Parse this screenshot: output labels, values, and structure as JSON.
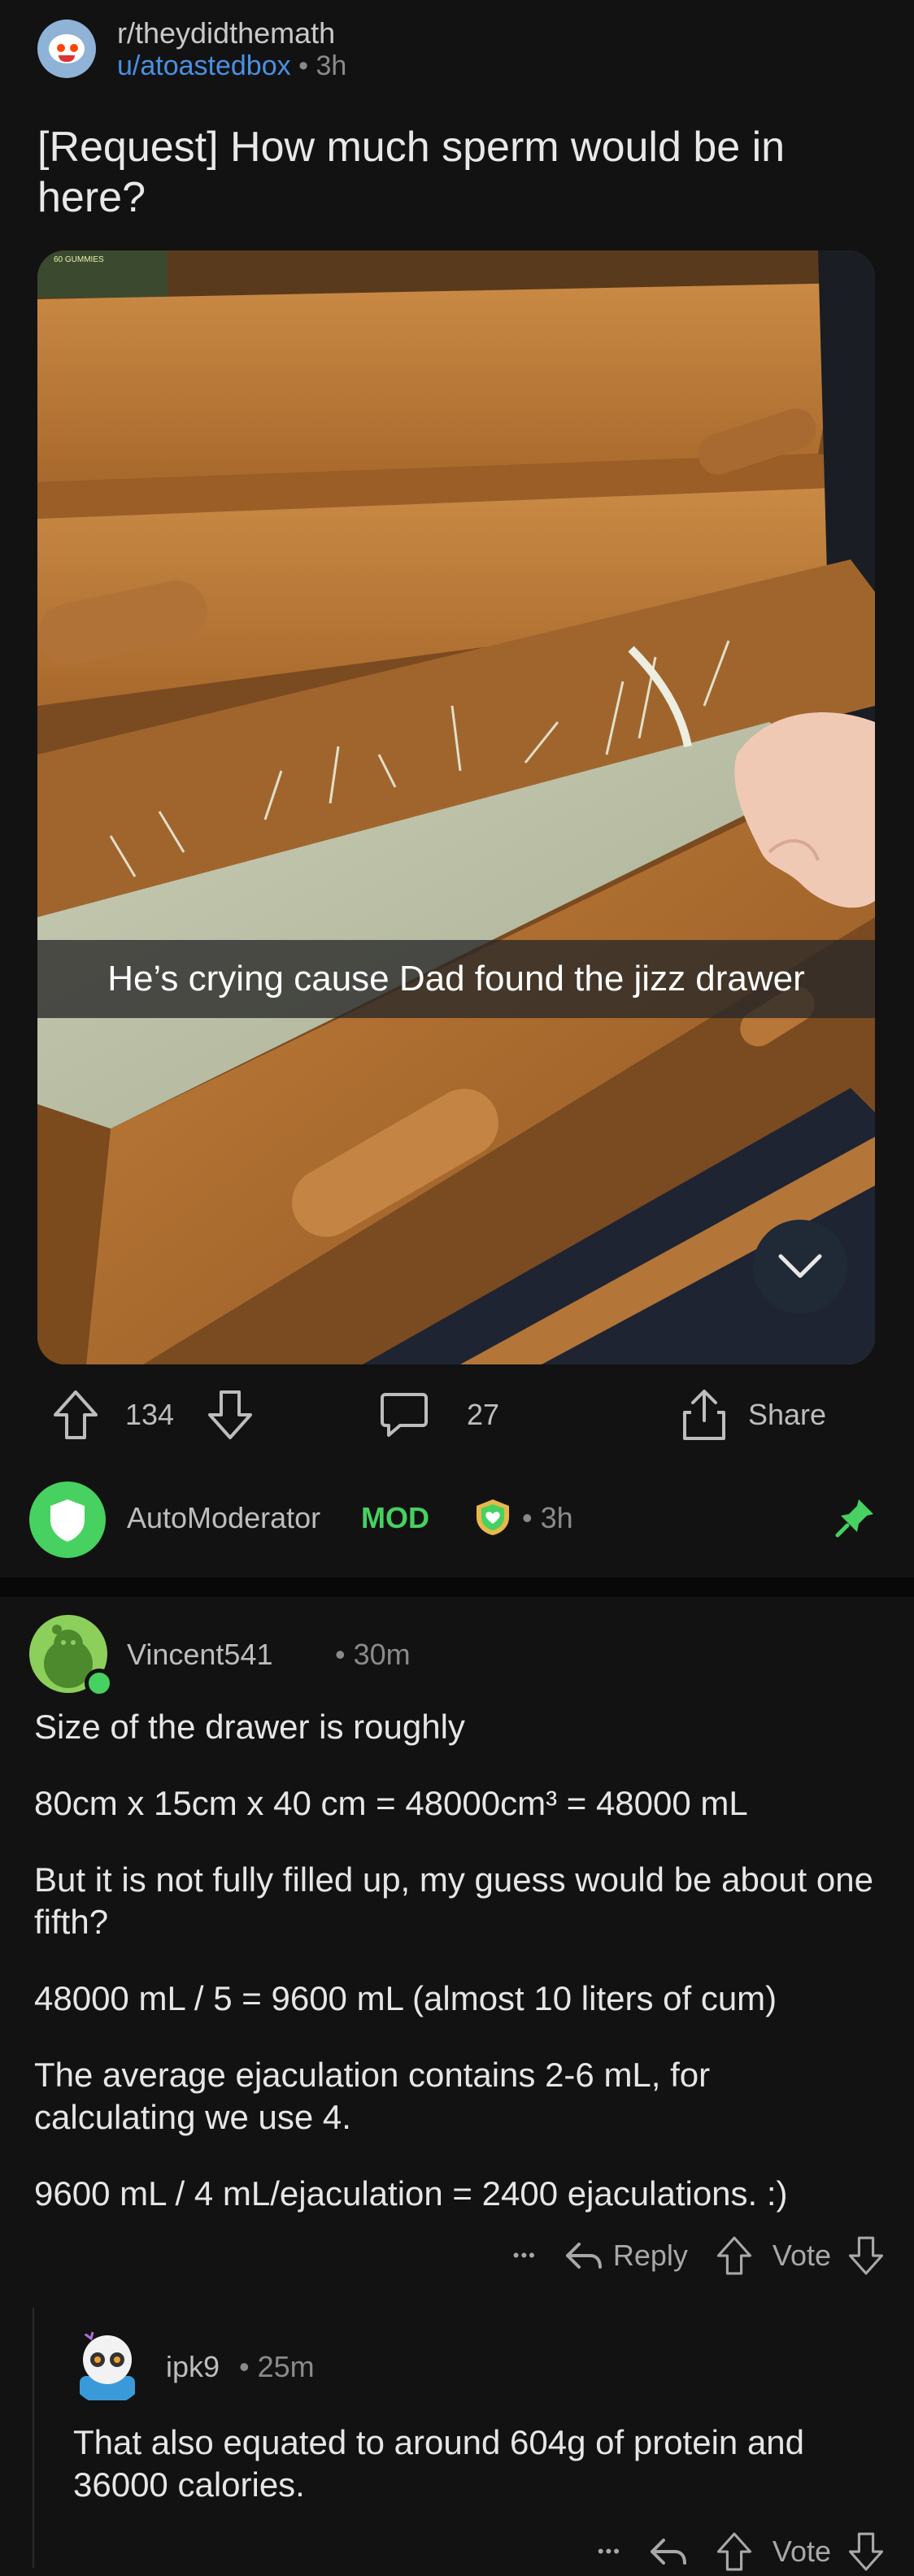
{
  "post": {
    "subreddit": "r/theydidthemath",
    "author": "u/atoastedbox",
    "separator": "•",
    "time": "3h",
    "title": "[Request] How much sperm would be in here?",
    "image_caption": "He’s crying cause Dad found the jizz drawer",
    "gummies_label": "60 GUMMIES",
    "upvotes": "134",
    "comments": "27",
    "share_label": "Share"
  },
  "automod": {
    "name": "AutoModerator",
    "badge": "MOD",
    "separator": "•",
    "time": "3h"
  },
  "comments": [
    {
      "author": "Vincent541",
      "separator": "•",
      "time": "30m",
      "paragraphs": [
        "Size of the drawer is roughly",
        "80cm x 15cm x 40 cm = 48000cm³ = 48000 mL",
        "But it is not fully filled up, my guess would be about one fifth?",
        "48000 mL / 5 = 9600 mL (almost 10 liters of cum)",
        "The average ejaculation contains 2-6 mL, for calculating we use 4.",
        "9600 mL / 4 mL/ejaculation = 2400 ejaculations. :)"
      ],
      "more": "•••",
      "reply": "Reply",
      "vote": "Vote"
    },
    {
      "author": "ipk9",
      "separator": "•",
      "time": "25m",
      "paragraphs": [
        "That also equated to around 604g of protein and 36000 calories."
      ],
      "more": "•••",
      "vote": "Vote"
    }
  ],
  "icons": {
    "upvote": "upvote-arrow-icon",
    "downvote": "downvote-arrow-icon",
    "comment": "comment-bubble-icon",
    "share": "share-icon",
    "collapse": "chevron-down-icon",
    "pin": "pin-icon",
    "reply": "reply-arrow-icon",
    "more": "more-dots-icon"
  },
  "colors": {
    "background": "#121212",
    "link_blue": "#4a90e2",
    "mod_green": "#46d160"
  }
}
